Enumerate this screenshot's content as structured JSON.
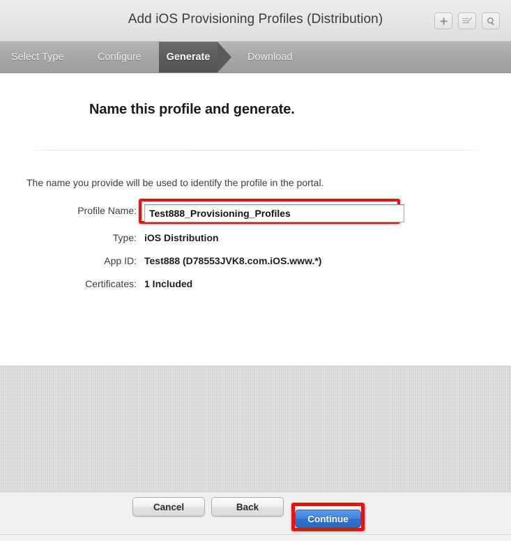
{
  "window": {
    "title": "Add iOS Provisioning Profiles (Distribution)",
    "actions": [
      {
        "name": "add-button",
        "icon": "plus-icon",
        "label": "+"
      },
      {
        "name": "edit-button",
        "icon": "edit-pencil-icon",
        "label": ""
      },
      {
        "name": "search-button",
        "icon": "search-icon",
        "label": ""
      }
    ]
  },
  "steps": {
    "items": [
      {
        "label": "Select Type",
        "active": false
      },
      {
        "label": "Configure",
        "active": false
      },
      {
        "label": "Generate",
        "active": true
      },
      {
        "label": "Download",
        "active": false
      }
    ],
    "active_label": "Generate"
  },
  "main": {
    "heading": "Name this profile and generate.",
    "intro": "The name you provide will be used to identify the profile in the portal.",
    "profile_name": {
      "label": "Profile Name:",
      "value": "Test888_Provisioning_Profiles",
      "placeholder": "Profile Name"
    },
    "fields": [
      {
        "label": "Type:",
        "value": "iOS Distribution"
      },
      {
        "label": "App ID:",
        "value": "Test888 (D78553JVK8.com.iOS.www.*)"
      },
      {
        "label": "Certificates:",
        "value": "1 Included"
      }
    ]
  },
  "footer": {
    "cancel_label": "Cancel",
    "back_label": "Back",
    "continue_label": "Continue"
  },
  "colors": {
    "annotation_red": "#e81010",
    "primary_blue": "#3f82d8",
    "step_active_gray": "#5a5a5a",
    "linen_gray": "#d6d7d9"
  }
}
